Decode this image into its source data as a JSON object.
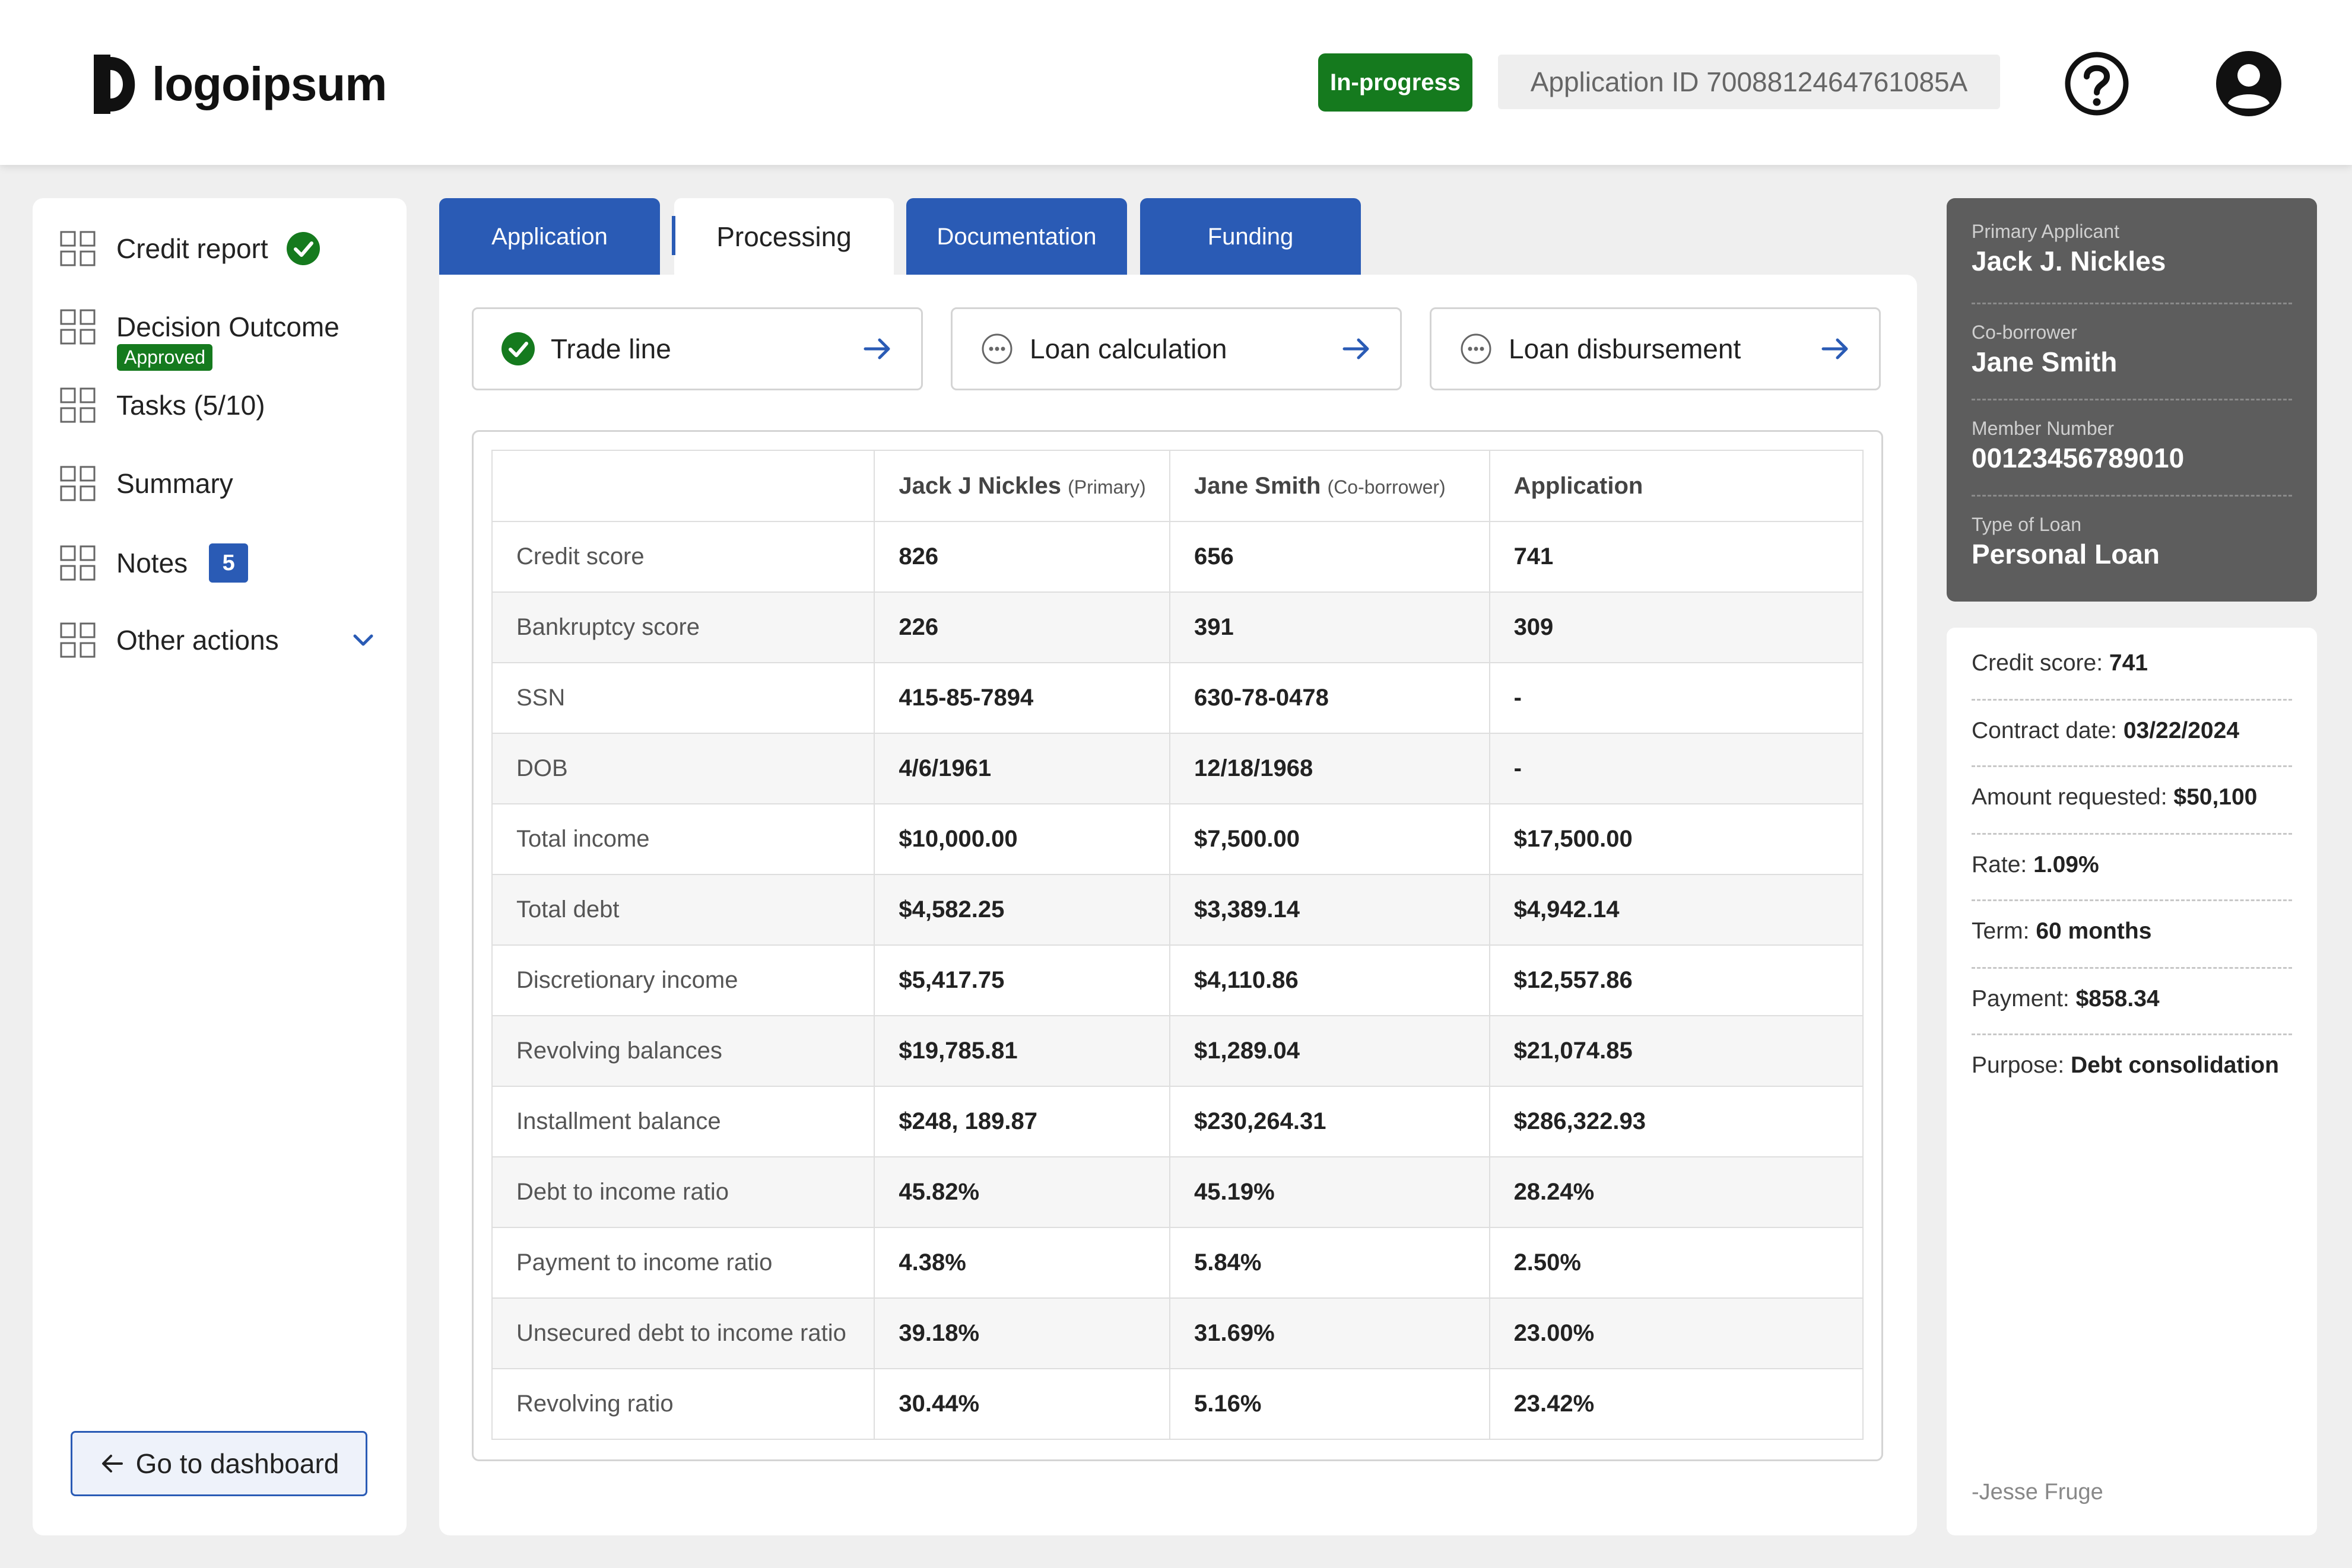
{
  "header": {
    "logo_text": "logoipsum",
    "status": "In-progress",
    "app_id": "Application ID 7008812464761085A",
    "colors": {
      "status": "#157a1e",
      "accent": "#2a5bb5"
    }
  },
  "sidebar": {
    "credit_report": "Credit report",
    "decision_outcome": "Decision Outcome",
    "decision_badge": "Approved",
    "tasks": "Tasks (5/10)",
    "summary": "Summary",
    "notes": "Notes",
    "notes_count": "5",
    "other_actions": "Other actions",
    "dashboard_button": "Go to dashboard"
  },
  "tabs": {
    "application": "Application",
    "processing": "Processing",
    "documentation": "Documentation",
    "funding": "Funding"
  },
  "steps": {
    "trade_line": "Trade line",
    "loan_calculation": "Loan calculation",
    "loan_disbursement": "Loan disbursement"
  },
  "table": {
    "col_primary_name": "Jack J Nickles",
    "col_primary_role": "(Primary)",
    "col_co_name": "Jane Smith",
    "col_co_role": "(Co-borrower)",
    "col_application": "Application",
    "rows": [
      {
        "label": "Credit score",
        "primary": "826",
        "co": "656",
        "app": "741"
      },
      {
        "label": "Bankruptcy score",
        "primary": "226",
        "co": "391",
        "app": "309"
      },
      {
        "label": "SSN",
        "primary": "415-85-7894",
        "co": "630-78-0478",
        "app": "-"
      },
      {
        "label": "DOB",
        "primary": "4/6/1961",
        "co": "12/18/1968",
        "app": "-"
      },
      {
        "label": "Total income",
        "primary": "$10,000.00",
        "co": "$7,500.00",
        "app": "$17,500.00"
      },
      {
        "label": "Total debt",
        "primary": "$4,582.25",
        "co": "$3,389.14",
        "app": "$4,942.14"
      },
      {
        "label": "Discretionary income",
        "primary": "$5,417.75",
        "co": "$4,110.86",
        "app": "$12,557.86"
      },
      {
        "label": "Revolving balances",
        "primary": "$19,785.81",
        "co": "$1,289.04",
        "app": "$21,074.85"
      },
      {
        "label": "Installment balance",
        "primary": "$248, 189.87",
        "co": "$230,264.31",
        "app": "$286,322.93"
      },
      {
        "label": "Debt to income ratio",
        "primary": "45.82%",
        "co": "45.19%",
        "app": "28.24%"
      },
      {
        "label": "Payment to income ratio",
        "primary": "4.38%",
        "co": "5.84%",
        "app": "2.50%"
      },
      {
        "label": "Unsecured debt to income ratio",
        "primary": "39.18%",
        "co": "31.69%",
        "app": "23.00%"
      },
      {
        "label": "Revolving ratio",
        "primary": "30.44%",
        "co": "5.16%",
        "app": "23.42%"
      }
    ]
  },
  "applicant": {
    "primary_label": "Primary Applicant",
    "primary_value": "Jack J. Nickles",
    "co_label": "Co-borrower",
    "co_value": "Jane Smith",
    "member_label": "Member Number",
    "member_value": "00123456789010",
    "loan_type_label": "Type of Loan",
    "loan_type_value": "Personal Loan"
  },
  "loan_summary": {
    "credit_score_label": "Credit score:",
    "credit_score": "741",
    "contract_date_label": "Contract date:",
    "contract_date": "03/22/2024",
    "amount_label": "Amount requested:",
    "amount": "$50,100",
    "rate_label": "Rate:",
    "rate": "1.09%",
    "term_label": "Term:",
    "term": "60 months",
    "payment_label": "Payment:",
    "payment": "$858.34",
    "purpose_label": "Purpose:",
    "purpose": "Debt consolidation",
    "signature": "-Jesse Fruge"
  }
}
